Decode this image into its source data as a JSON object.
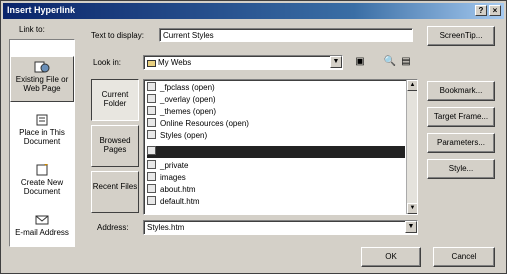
{
  "window": {
    "title": "Insert Hyperlink",
    "help_glyph": "?",
    "close_glyph": "×"
  },
  "link_to": {
    "label": "Link to:",
    "items": [
      {
        "label": "Existing File or Web Page",
        "icon": "globe-document-icon"
      },
      {
        "label": "Place in This Document",
        "icon": "document-place-icon"
      },
      {
        "label": "Create New Document",
        "icon": "new-document-icon"
      },
      {
        "label": "E-mail Address",
        "icon": "envelope-icon"
      }
    ]
  },
  "text_to_display": {
    "label": "Text to display:",
    "value": "Current Styles"
  },
  "screentip_button": "ScreenTip...",
  "look_in": {
    "label": "Look in:",
    "value": "My Webs"
  },
  "look_tabs": [
    {
      "label": "Current Folder"
    },
    {
      "label": "Browsed Pages"
    },
    {
      "label": "Recent Files"
    }
  ],
  "files": [
    {
      "name": "_fpclass (open)"
    },
    {
      "name": "_overlay (open)"
    },
    {
      "name": "_themes (open)"
    },
    {
      "name": "Online Resources (open)"
    },
    {
      "name": "Styles (open)"
    },
    {
      "name": ""
    },
    {
      "name": "_private"
    },
    {
      "name": "images"
    },
    {
      "name": "about.htm"
    },
    {
      "name": "default.htm"
    }
  ],
  "address": {
    "label": "Address:",
    "value": "Styles.htm"
  },
  "side_buttons": [
    "Bookmark...",
    "Target Frame...",
    "Parameters...",
    "Style..."
  ],
  "ok_button": "OK",
  "cancel_button": "Cancel",
  "colors": {
    "titlebar": "#0a246a",
    "face": "#d4d0c8",
    "selection": "#222222"
  }
}
